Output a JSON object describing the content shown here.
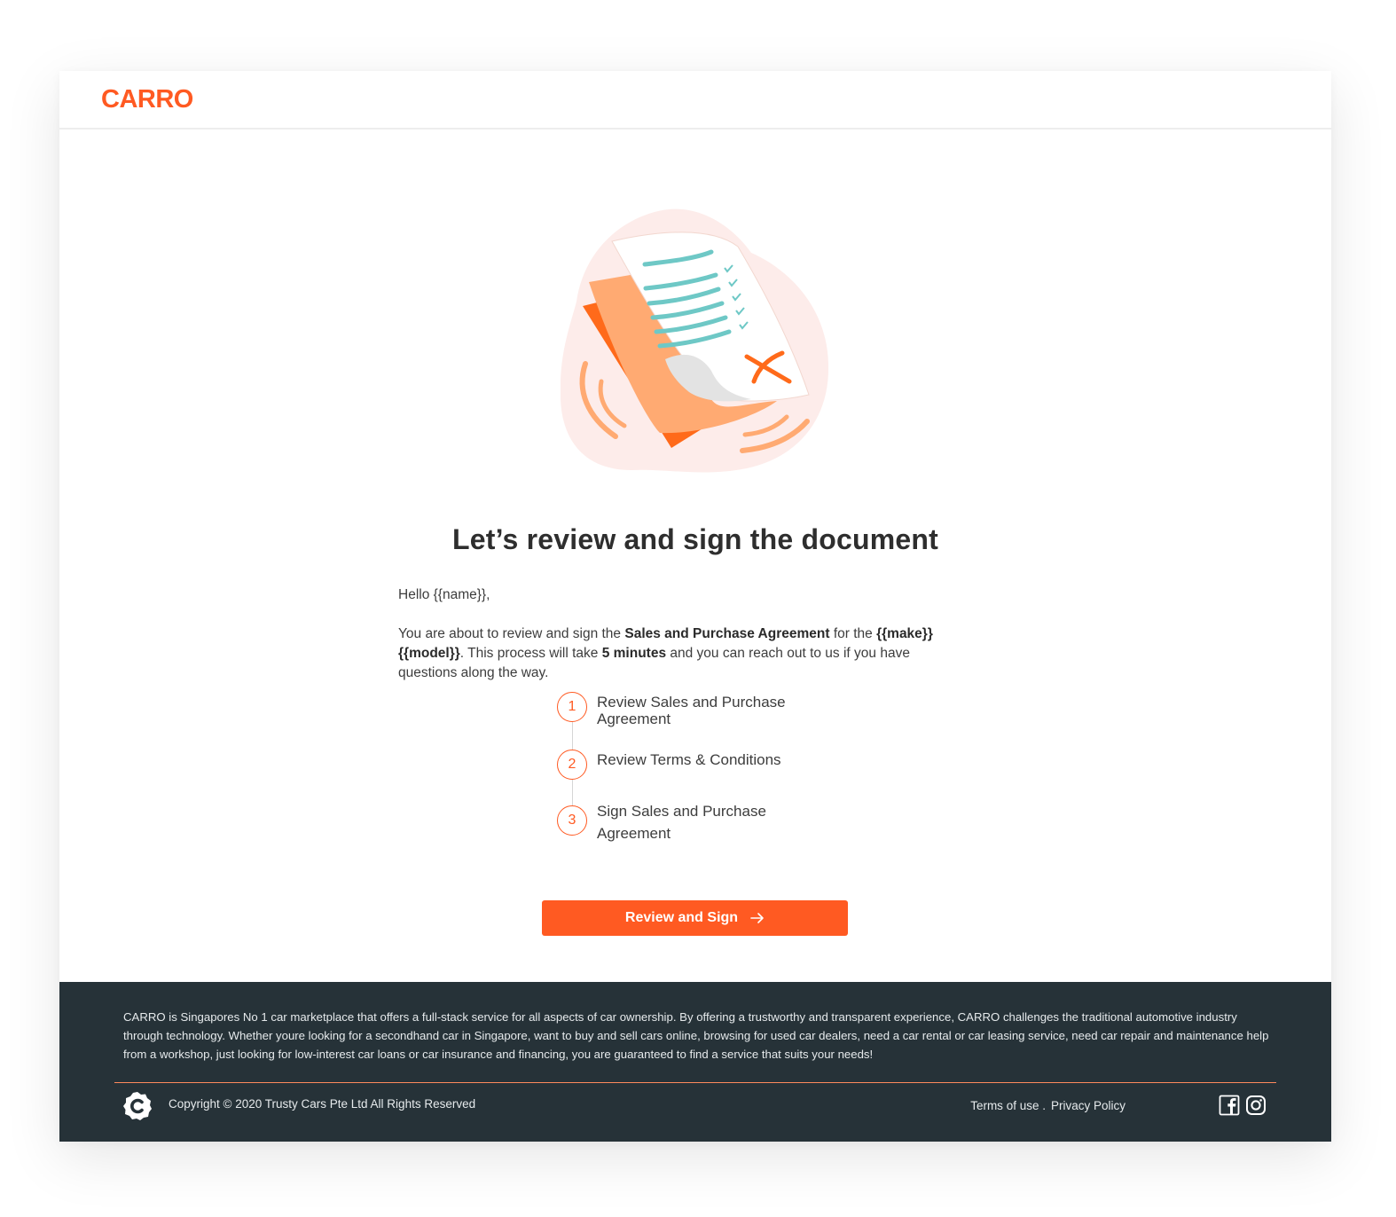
{
  "brand": {
    "logo_text": "CARRO",
    "accent_color": "#ff5a22",
    "footer_bg": "#263238"
  },
  "main": {
    "illustration_icon": "document-sign-icon",
    "title": "Let’s review and sign the document",
    "greeting": "Hello {{name}},",
    "intro": {
      "p1": "You are about to review and sign the ",
      "agreement": "Sales and Purchase Agreement",
      "p2": " for the ",
      "make_model": "{{make}} {{model}}",
      "p3": ". This process will take ",
      "duration": "5 minutes",
      "p4": " and you can reach out to us if you have questions along the way."
    },
    "steps": [
      {
        "number": "1",
        "label": "Review Sales and Purchase Agreement"
      },
      {
        "number": "2",
        "label": "Review Terms & Conditions"
      },
      {
        "number": "3",
        "label": "Sign Sales and Purchase Agreement"
      }
    ],
    "cta_label": "Review and Sign",
    "cta_icon": "arrow-right-icon"
  },
  "footer": {
    "description": "CARRO is Singapores No 1 car marketplace that offers a full-stack service for all aspects of car ownership. By offering a trustworthy and transparent experience, CARRO challenges the traditional automotive industry through technology. Whether youre looking for a secondhand car in Singapore, want to buy and sell cars online, browsing for used car dealers, need a car rental or car leasing service, need car repair and maintenance help from a workshop, just looking for low-interest car loans or car insurance and financing, you are guaranteed to find a service that suits your needs!",
    "copyright": "Copyright © 2020 Trusty Cars Pte Ltd All Rights Reserved",
    "terms_label": "Terms of use .",
    "privacy_label": "Privacy Policy",
    "badge_icon": "carro-badge-icon",
    "social": [
      "facebook-icon",
      "instagram-icon"
    ]
  }
}
